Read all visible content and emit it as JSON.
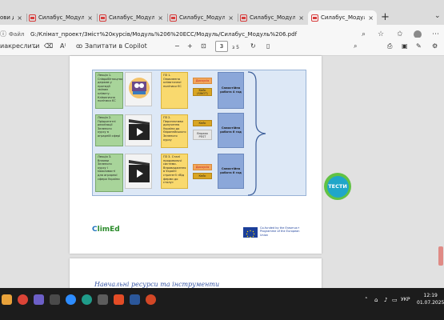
{
  "browser": {
    "tabs": [
      {
        "label": "ови д"
      },
      {
        "label": "Силабус_Модуль 6.pdf"
      },
      {
        "label": "Силабус_Модуль 6.pdf"
      },
      {
        "label": "Силабус_Модуль 6.pdf"
      },
      {
        "label": "Силабус_Модуль 6.pdf"
      },
      {
        "label": "Силабус_Модуль 6.pdf"
      }
    ],
    "new_tab": "+",
    "address": {
      "file_label": "Файл",
      "url": "G:/Клімат_проект/Зміст%20курсів/Модуль%206%20ECC/Модуль/Силабус_Модуль%206.pdf"
    }
  },
  "pdf_toolbar": {
    "read_aloud": "иакреслити",
    "ask_copilot": "Запитати в Copilot",
    "zoom_out": "−",
    "zoom_in": "+",
    "page_current": "3",
    "page_total": "з 5"
  },
  "diagram": {
    "rows": [
      {
        "lecture": "Лекція 1. Співробітництво держав у протидії змінам клімату. Кліматична політика ЄС",
        "practice": "ПЗ 1. Оновлення кліматичної політики ЄС",
        "chips": [
          "Дискусія",
          "Кейс (SWOT)"
        ],
        "self": "Самостійна робота 4 год"
      },
      {
        "lecture": "Лекція 2. Пріоритетні реалізації Зеленого курсу в аграрній сфері",
        "practice": "ПЗ 2. Перспективи долучення України до Європейського Зеленого курсу",
        "chips": [
          "Кейс",
          "Вправа PEST"
        ],
        "self": "Самостійна робота 6 год"
      },
      {
        "lecture": "Лекція 3. Впливи Зеленого курсу і можливості для аграрної сфери України",
        "practice": "ПЗ 3. Сталі продовольчі системи. Впровадження в Україні стратегії «Від ферми до столу»",
        "chips": [
          "Дискусія",
          "Кейс"
        ],
        "self": "Самостійна робота 6 год"
      }
    ],
    "tests_label": "ТЕСТИ"
  },
  "footer": {
    "climed_prefix": "C",
    "climed_rest": "limEd",
    "eu_text": "Co-funded by the Erasmus+ Programme of the European Union"
  },
  "page2": {
    "heading": "Навчальні ресурси та інструменти"
  },
  "taskbar": {
    "lang": "УКР",
    "time": "12:19",
    "date": "01.07.2025"
  },
  "colors": {
    "pdf_tab_icon": "#d83b3b",
    "lecture_green": "#a8d49a",
    "practice_yellow": "#f9d96e",
    "self_blue": "#8ba7d9",
    "tests_green": "#61c244",
    "tests_blue": "#1fa6c9"
  }
}
